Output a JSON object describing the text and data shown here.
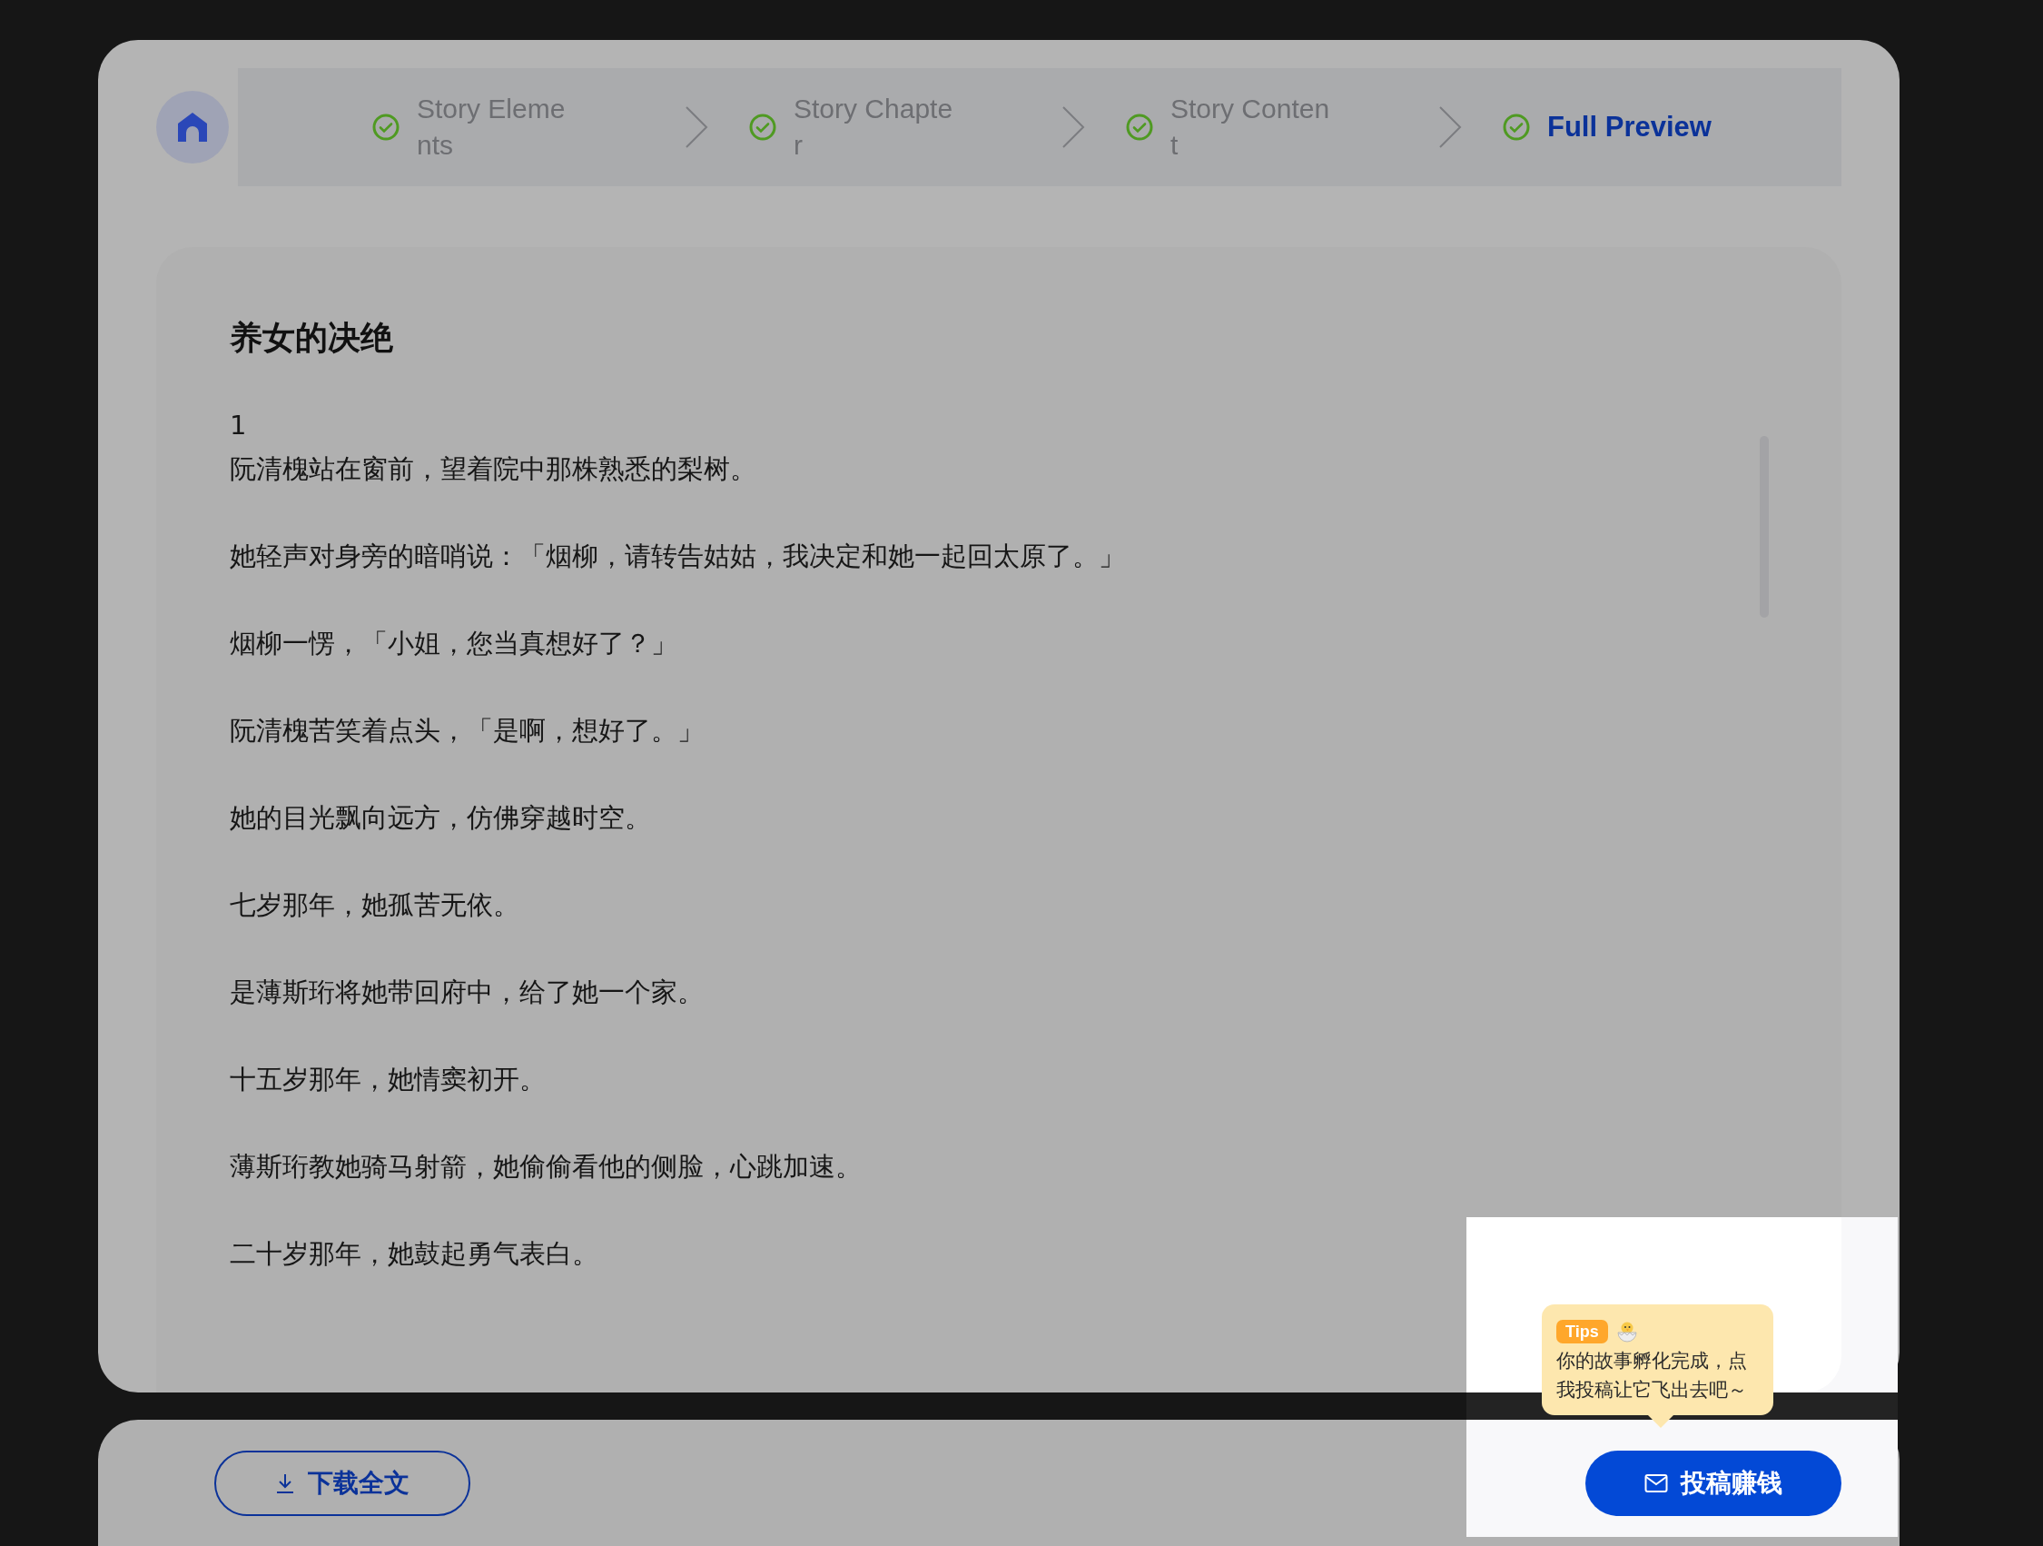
{
  "stepper": {
    "steps": [
      {
        "label": "Story Elements",
        "completed": true,
        "selected": false
      },
      {
        "label": "Story Chapter",
        "completed": true,
        "selected": false
      },
      {
        "label": "Story Content",
        "completed": true,
        "selected": false
      },
      {
        "label": "Full Preview",
        "completed": true,
        "selected": true
      }
    ]
  },
  "story": {
    "title": "养女的决绝",
    "paragraphs": [
      {
        "lines": [
          "1",
          "阮清槐站在窗前，望着院中那株熟悉的梨树。"
        ]
      },
      {
        "lines": [
          "她轻声对身旁的暗哨说：「烟柳，请转告姑姑，我决定和她一起回太原了。」"
        ]
      },
      {
        "lines": [
          "烟柳一愣，「小姐，您当真想好了？」"
        ]
      },
      {
        "lines": [
          "阮清槐苦笑着点头，「是啊，想好了。」"
        ]
      },
      {
        "lines": [
          "她的目光飘向远方，仿佛穿越时空。"
        ]
      },
      {
        "lines": [
          "七岁那年，她孤苦无依。"
        ]
      },
      {
        "lines": [
          "是薄斯珩将她带回府中，给了她一个家。"
        ]
      },
      {
        "lines": [
          "十五岁那年，她情窦初开。"
        ]
      },
      {
        "lines": [
          "薄斯珩教她骑马射箭，她偷偷看他的侧脸，心跳加速。"
        ]
      },
      {
        "lines": [
          "二十岁那年，她鼓起勇气表白。"
        ]
      }
    ]
  },
  "footer": {
    "download_button": "下载全文",
    "submit_button": "投稿赚钱"
  },
  "tooltip": {
    "badge": "Tips",
    "text": "你的故事孵化完成，点我投稿让它飞出去吧～"
  }
}
